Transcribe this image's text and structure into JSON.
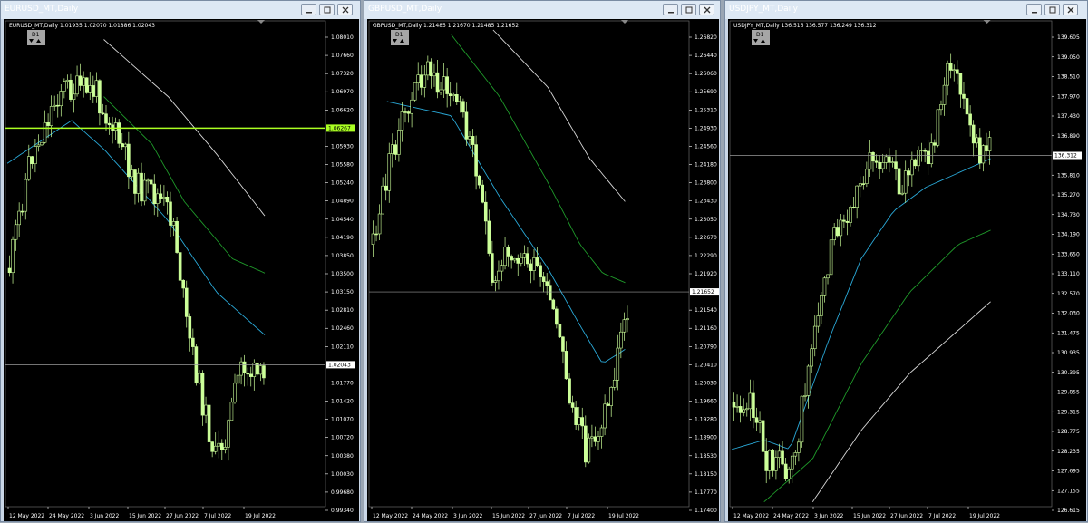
{
  "windows": [
    {
      "title": "EURUSD_MT,Daily",
      "header": "EURUSD_MT,Daily   1.01935 1.02070 1.01886 1.02043",
      "timeframe": "D1",
      "price_axis": [
        "1.08010",
        "1.07660",
        "1.07320",
        "1.06970",
        "1.06620",
        "1.06267",
        "1.05930",
        "1.05580",
        "1.05240",
        "1.04890",
        "1.04540",
        "1.04190",
        "1.03850",
        "1.03500",
        "1.03150",
        "1.02810",
        "1.02460",
        "1.02110",
        "1.02043",
        "1.01770",
        "1.01420",
        "1.01070",
        "1.00720",
        "1.00380",
        "1.00030",
        "0.99680",
        "0.99340"
      ],
      "date_axis": [
        "12 May 2022",
        "24 May 2022",
        "3 Jun 2022",
        "15 Jun 2022",
        "27 Jun 2022",
        "7 Jul 2022",
        "19 Jul 2022"
      ],
      "current_price_label": "1.02043",
      "level_label": "1.06267",
      "colors": {
        "level_line": "#aaff22",
        "price_line": "#9a9a9a",
        "candle": "#ccff99",
        "ma_fast": "#2aa9d8",
        "ma_mid": "#1f9a2a",
        "ma_slow": "#d8d8d8"
      }
    },
    {
      "title": "GBPUSD_MT,Daily",
      "header": "GBPUSD_MT,Daily   1.21485 1.21670 1.21485 1.21652",
      "timeframe": "D1",
      "price_axis": [
        "1.26820",
        "1.26440",
        "1.26060",
        "1.25690",
        "1.25310",
        "1.24930",
        "1.24560",
        "1.24180",
        "1.23800",
        "1.23430",
        "1.23050",
        "1.22670",
        "1.22290",
        "1.21920",
        "1.21652",
        "1.21540",
        "1.21160",
        "1.20790",
        "1.20410",
        "1.20030",
        "1.19660",
        "1.19280",
        "1.18900",
        "1.18530",
        "1.18150",
        "1.17770",
        "1.17400"
      ],
      "date_axis": [
        "12 May 2022",
        "24 May 2022",
        "3 Jun 2022",
        "15 Jun 2022",
        "27 Jun 2022",
        "7 Jul 2022",
        "19 Jul 2022"
      ],
      "current_price_label": "1.21652",
      "colors": {
        "price_line": "#9a9a9a",
        "candle": "#ccff99",
        "ma_fast": "#2aa9d8",
        "ma_mid": "#1f9a2a",
        "ma_slow": "#d8d8d8"
      }
    },
    {
      "title": "USDJPY_MT,Daily",
      "header": "USDJPY_MT,Daily   136.516 136.577 136.249 136.312",
      "timeframe": "D1",
      "price_axis": [
        "139.605",
        "139.050",
        "138.510",
        "137.970",
        "137.430",
        "136.890",
        "136.312",
        "135.810",
        "135.270",
        "134.730",
        "134.190",
        "133.650",
        "133.110",
        "132.570",
        "132.030",
        "131.475",
        "130.935",
        "130.395",
        "129.855",
        "129.315",
        "128.775",
        "128.235",
        "127.695",
        "127.155",
        "126.615"
      ],
      "date_axis": [
        "12 May 2022",
        "24 May 2022",
        "3 Jun 2022",
        "15 Jun 2022",
        "27 Jun 2022",
        "7 Jul 2022",
        "19 Jul 2022"
      ],
      "current_price_label": "136.312",
      "colors": {
        "price_line": "#9a9a9a",
        "candle": "#ccff99",
        "ma_fast": "#2aa9d8",
        "ma_mid": "#1f9a2a",
        "ma_slow": "#d8d8d8"
      }
    }
  ],
  "window_buttons": {
    "minimize": "minimize-icon",
    "maximize": "maximize-icon",
    "close": "close-icon"
  }
}
